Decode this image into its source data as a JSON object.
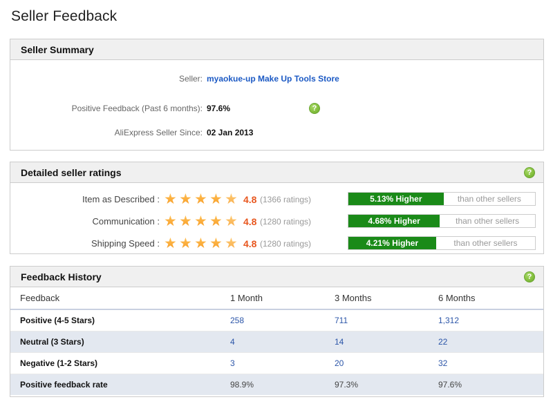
{
  "page": {
    "title": "Seller Feedback"
  },
  "icons": {
    "help": "?",
    "star": "★"
  },
  "colors": {
    "link": "#1b59c4",
    "score": "#e8571f",
    "bar_green": "#1a8a18",
    "panel_header_bg": "#f0f0f0",
    "alt_row_bg": "#e3e8f0"
  },
  "summary": {
    "heading": "Seller Summary",
    "rows": [
      {
        "label": "Seller:",
        "value": "myaokue-up Make Up Tools Store",
        "style": "link",
        "help": false
      },
      {
        "label": "Positive Feedback (Past 6 months):",
        "value": "97.6%",
        "style": "plain",
        "help": true
      },
      {
        "label": "AliExpress Seller Since:",
        "value": "02 Jan 2013",
        "style": "plain",
        "help": false
      }
    ]
  },
  "ratings": {
    "heading": "Detailed seller ratings",
    "help_icon": "?",
    "comparison_suffix": "than other sellers",
    "rows": [
      {
        "label": "Item as Described :",
        "stars": 5,
        "score": "4.8",
        "count": "(1366 ratings)",
        "delta": "5.13% Higher",
        "delta_width_pct": 51,
        "suffix": "than other sellers"
      },
      {
        "label": "Communication :",
        "stars": 5,
        "score": "4.8",
        "count": "(1280 ratings)",
        "delta": "4.68% Higher",
        "delta_width_pct": 49,
        "suffix": "than other sellers"
      },
      {
        "label": "Shipping Speed :",
        "stars": 5,
        "score": "4.8",
        "count": "(1280 ratings)",
        "delta": "4.21% Higher",
        "delta_width_pct": 47,
        "suffix": "than other sellers"
      }
    ]
  },
  "history": {
    "heading": "Feedback History",
    "help_icon": "?",
    "columns": [
      "Feedback",
      "1 Month",
      "3 Months",
      "6 Months"
    ],
    "rows": [
      {
        "label": "Positive (4-5 Stars)",
        "values": [
          "258",
          "711",
          "1,312"
        ],
        "kind": "num"
      },
      {
        "label": "Neutral (3 Stars)",
        "values": [
          "4",
          "14",
          "22"
        ],
        "kind": "num"
      },
      {
        "label": "Negative (1-2 Stars)",
        "values": [
          "3",
          "20",
          "32"
        ],
        "kind": "num"
      },
      {
        "label": "Positive feedback rate",
        "values": [
          "98.9%",
          "97.3%",
          "97.6%"
        ],
        "kind": "pct"
      }
    ]
  }
}
